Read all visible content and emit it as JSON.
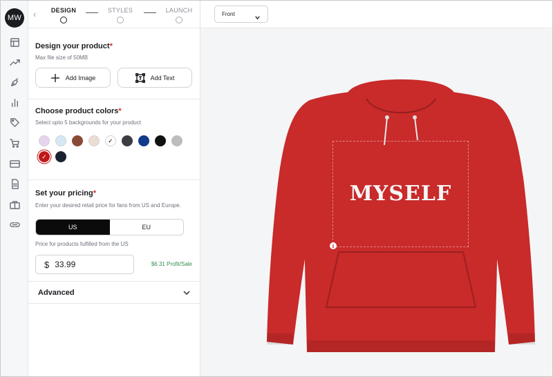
{
  "user": {
    "initials": "MW"
  },
  "steps": [
    {
      "label": "DESIGN",
      "active": true
    },
    {
      "label": "STYLES",
      "active": false
    },
    {
      "label": "LAUNCH",
      "active": false
    }
  ],
  "sidebar_icons": [
    "layout-icon",
    "trending-icon",
    "pen-tool-icon",
    "bar-chart-icon",
    "tag-icon",
    "cart-icon",
    "credit-card-icon",
    "document-icon",
    "briefcase-icon",
    "link-icon"
  ],
  "design": {
    "title": "Design your product",
    "required_mark": "*",
    "subtitle": "Max file size of 50MB",
    "add_image_label": "Add Image",
    "add_text_label": "Add Text"
  },
  "colors": {
    "title": "Choose product colors",
    "required_mark": "*",
    "subtitle": "Select upto 5 backgrounds for your product",
    "swatches": [
      {
        "hex": "#e6d4ef",
        "selected": false
      },
      {
        "hex": "#d5e8f3",
        "selected": false
      },
      {
        "hex": "#8b4a38",
        "selected": false
      },
      {
        "hex": "#eaded4",
        "selected": false
      },
      {
        "hex": "#ffffff",
        "selected": true
      },
      {
        "hex": "#3b3d40",
        "selected": false
      },
      {
        "hex": "#123a8c",
        "selected": false
      },
      {
        "hex": "#111111",
        "selected": false
      },
      {
        "hex": "#bdbdbd",
        "selected": false
      },
      {
        "hex": "#c01818",
        "selected": true
      },
      {
        "hex": "#1a2230",
        "selected": false
      }
    ]
  },
  "pricing": {
    "title": "Set your pricing",
    "required_mark": "*",
    "subtitle": "Enter your desired retail price for fans from US and Europe.",
    "regions": [
      "US",
      "EU"
    ],
    "active_region": "US",
    "fulfilled_note": "Price for products fulfilled from the US",
    "currency": "$",
    "price": "33.99",
    "profit": "$6.31 Profit/Sale"
  },
  "advanced": {
    "label": "Advanced"
  },
  "canvas": {
    "view": "Front",
    "print_text": "MYSELF",
    "product_color": "#c92a2a",
    "info_glyph": "i"
  }
}
